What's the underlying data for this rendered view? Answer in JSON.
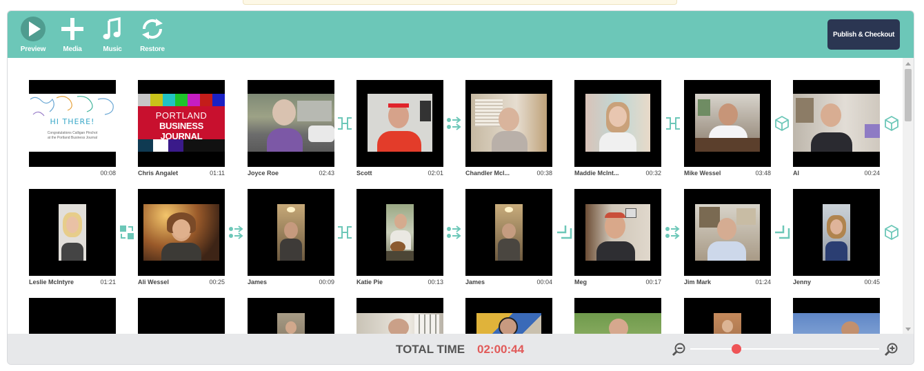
{
  "toolbar": {
    "preview_label": "Preview",
    "media_label": "Media",
    "music_label": "Music",
    "restore_label": "Restore",
    "publish_label": "Publish & Checkout"
  },
  "colors": {
    "toolbar_bg": "#6cc7b8",
    "publish_bg": "#2b3652",
    "accent": "#6cc7b8",
    "total_time": "#e15a59",
    "slider_knob": "#ef5457"
  },
  "clips_row1": [
    {
      "name": "",
      "duration": "00:08"
    },
    {
      "name": "Chris Angalet",
      "duration": "01:11"
    },
    {
      "name": "Joyce Roe",
      "duration": "02:43"
    },
    {
      "name": "Scott",
      "duration": "02:01"
    },
    {
      "name": "Chandler Mcl...",
      "duration": "00:38"
    },
    {
      "name": "Maddie McInt...",
      "duration": "00:32"
    },
    {
      "name": "Mike Wessel",
      "duration": "03:48"
    },
    {
      "name": "Al",
      "duration": "00:24"
    }
  ],
  "clips_row2": [
    {
      "name": "Leslie McIntyre",
      "duration": "01:21"
    },
    {
      "name": "Ali Wessel",
      "duration": "00:25"
    },
    {
      "name": "James",
      "duration": "00:09"
    },
    {
      "name": "Katie Pie",
      "duration": "00:13"
    },
    {
      "name": "James",
      "duration": "00:04"
    },
    {
      "name": "Meg",
      "duration": "00:17"
    },
    {
      "name": "Jim Mark",
      "duration": "01:24"
    },
    {
      "name": "Jenny",
      "duration": "00:45"
    }
  ],
  "intro_card": {
    "headline": "HI THERE!",
    "line1": "Congratulations Calligan Pinchot",
    "line2": "at the Portland Business Journal"
  },
  "logo_card": {
    "line1": "PORTLAND",
    "line2": "BUSINESS JOURNAL"
  },
  "transitions_row1": [
    "bracket-icon",
    "dots-arrows-icon",
    "bracket-icon",
    "cube-icon",
    "cube-icon"
  ],
  "transitions_row2": [
    "swap-icon",
    "dots-arrows-icon",
    "bracket-icon",
    "dots-arrows-icon",
    "corner-icon",
    "dots-arrows-icon",
    "corner-icon",
    "cube-icon"
  ],
  "footer": {
    "total_label": "TOTAL TIME",
    "total_value": "02:00:44",
    "zoom_level": 0.25
  }
}
